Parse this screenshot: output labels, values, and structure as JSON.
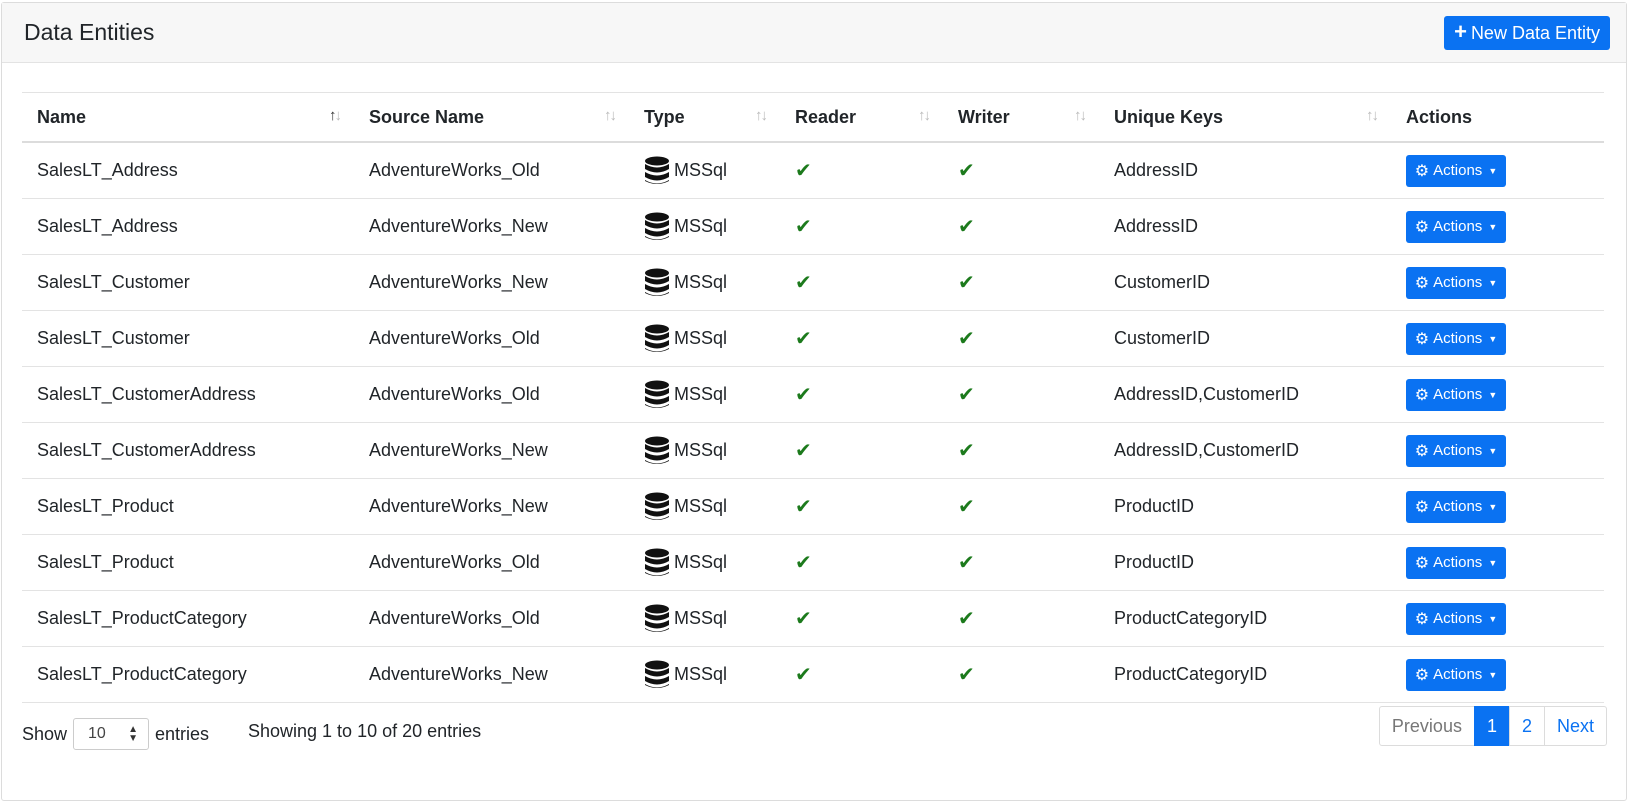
{
  "header": {
    "title": "Data Entities",
    "new_button_label": "New Data Entity"
  },
  "table": {
    "columns": [
      "Name",
      "Source Name",
      "Type",
      "Reader",
      "Writer",
      "Unique Keys",
      "Actions"
    ],
    "rows": [
      {
        "name": "SalesLT_Address",
        "source": "AdventureWorks_Old",
        "type": "MSSql",
        "keys": "AddressID"
      },
      {
        "name": "SalesLT_Address",
        "source": "AdventureWorks_New",
        "type": "MSSql",
        "keys": "AddressID"
      },
      {
        "name": "SalesLT_Customer",
        "source": "AdventureWorks_New",
        "type": "MSSql",
        "keys": "CustomerID"
      },
      {
        "name": "SalesLT_Customer",
        "source": "AdventureWorks_Old",
        "type": "MSSql",
        "keys": "CustomerID"
      },
      {
        "name": "SalesLT_CustomerAddress",
        "source": "AdventureWorks_Old",
        "type": "MSSql",
        "keys": "AddressID,CustomerID"
      },
      {
        "name": "SalesLT_CustomerAddress",
        "source": "AdventureWorks_New",
        "type": "MSSql",
        "keys": "AddressID,CustomerID"
      },
      {
        "name": "SalesLT_Product",
        "source": "AdventureWorks_New",
        "type": "MSSql",
        "keys": "ProductID"
      },
      {
        "name": "SalesLT_Product",
        "source": "AdventureWorks_Old",
        "type": "MSSql",
        "keys": "ProductID"
      },
      {
        "name": "SalesLT_ProductCategory",
        "source": "AdventureWorks_Old",
        "type": "MSSql",
        "keys": "ProductCategoryID"
      },
      {
        "name": "SalesLT_ProductCategory",
        "source": "AdventureWorks_New",
        "type": "MSSql",
        "keys": "ProductCategoryID"
      }
    ],
    "action_label": "Actions"
  },
  "footer": {
    "show_label": "Show",
    "page_length": "10",
    "entries_label": "entries",
    "info": "Showing 1 to 10 of 20 entries",
    "pagination": {
      "previous": "Previous",
      "pages": [
        "1",
        "2"
      ],
      "next": "Next"
    }
  },
  "colors": {
    "primary": "#0a72f2",
    "check": "#1c7a1c"
  }
}
